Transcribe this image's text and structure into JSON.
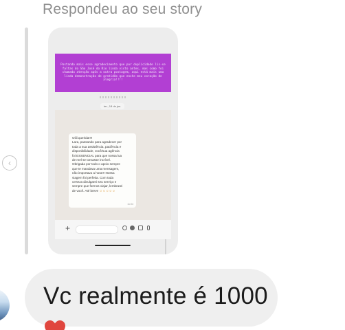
{
  "reply": {
    "label": "Respondeu ao seu story"
  },
  "story": {
    "banner_text": "Postando mais esse agradecimento que por duplicidade lis-se faltas do São José do Rio linda visto antes, mas como foi chamada atenção após a outra postagem, aqui está mais uma linda demonstração de gratidão que enche meu coração de alegria!!!!",
    "date_chip": "ter., 18 de jun.",
    "message_lines": [
      "Oiiii querida!!!!",
      "Lara, passando para agradecer por",
      "toda a sua assistência, paciência e",
      "disponibilidade, você/sua agência",
      "foi ESSENCIAL para que nossa lua",
      "de mel se tornasse incrível.",
      "Obrigada por todo o apoio sempre",
      "que te mandava uma mensagem,",
      "não importava a hora!!! Nossa",
      "viagem foi perfeita. Com toda",
      "certeza divulgarei seu serviço e",
      "sempre que formos viajar, lembrarei",
      "de você. Até breve"
    ],
    "message_emojis": "☺☺☺☺☺",
    "message_time": "11:04",
    "input_plus": "+"
  },
  "nav": {
    "prev_glyph": "‹"
  },
  "message": {
    "text": "Vc realmente é 1000"
  },
  "icons": {
    "story_nav": "chevron-left-icon",
    "reaction": "heart-icon"
  },
  "colors": {
    "banner": "#b23fd3",
    "bubble": "#efefef",
    "heart": "#e0463e",
    "secondary_text": "#8e8e8e"
  }
}
